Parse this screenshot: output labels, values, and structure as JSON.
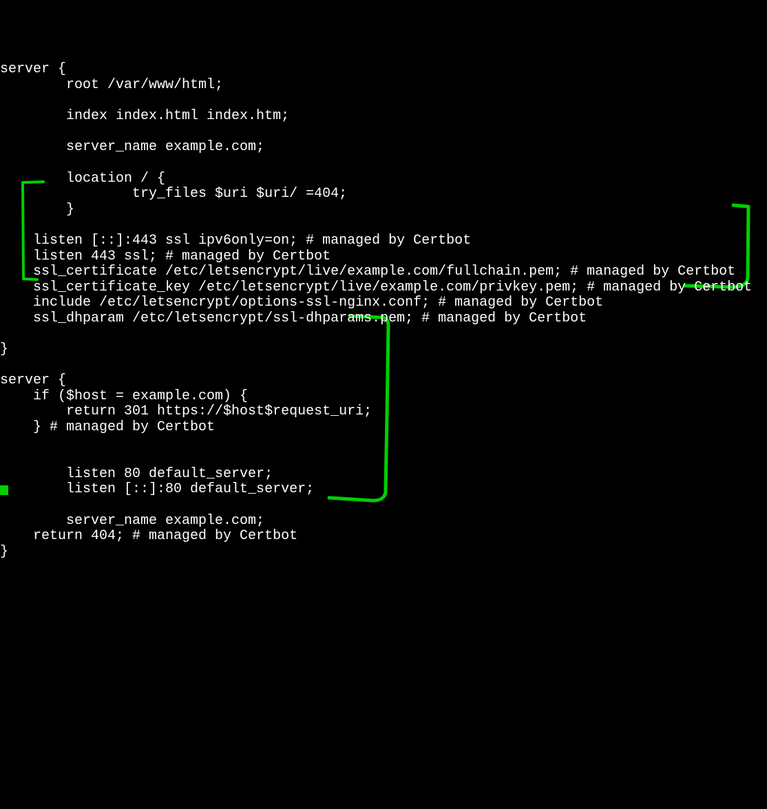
{
  "lines": [
    "server {",
    "        root /var/www/html;",
    "",
    "        index index.html index.htm;",
    "",
    "        server_name example.com;",
    "",
    "        location / {",
    "                try_files $uri $uri/ =404;",
    "        }",
    "",
    "    listen [::]:443 ssl ipv6only=on; # managed by Certbot",
    "    listen 443 ssl; # managed by Certbot",
    "    ssl_certificate /etc/letsencrypt/live/example.com/fullchain.pem; # managed by Certbot",
    "    ssl_certificate_key /etc/letsencrypt/live/example.com/privkey.pem; # managed by Certbot",
    "    include /etc/letsencrypt/options-ssl-nginx.conf; # managed by Certbot",
    "    ssl_dhparam /etc/letsencrypt/ssl-dhparams.pem; # managed by Certbot",
    "",
    "}",
    "",
    "server {",
    "    if ($host = example.com) {",
    "        return 301 https://$host$request_uri;",
    "    } # managed by Certbot",
    "",
    "",
    "        listen 80 default_server;",
    "        listen [::]:80 default_server;",
    "",
    "        server_name example.com;",
    "    return 404; # managed by Certbot",
    "}"
  ],
  "annotation_color": "#00d000"
}
